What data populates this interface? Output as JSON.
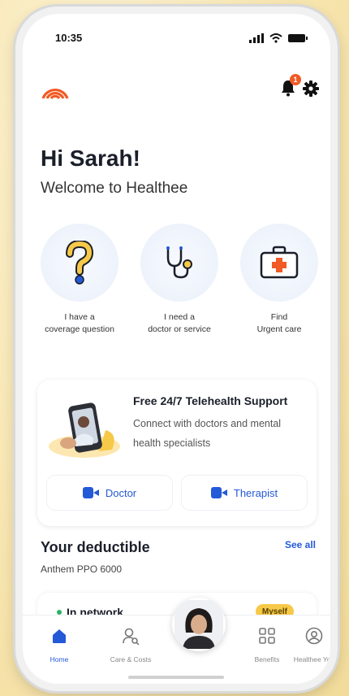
{
  "status_bar": {
    "time": "10:35"
  },
  "header": {
    "notification_count": "1"
  },
  "greeting": {
    "title": "Hi Sarah!",
    "subtitle": "Welcome to Healthee"
  },
  "quick_actions": [
    {
      "icon": "question-mark-icon",
      "line1": "I have a",
      "line2": "coverage question"
    },
    {
      "icon": "stethoscope-icon",
      "line1": "I need a",
      "line2": "doctor or service"
    },
    {
      "icon": "first-aid-kit-icon",
      "line1": "Find",
      "line2": "Urgent care"
    }
  ],
  "telehealth": {
    "title": "Free 24/7 Telehealth Support",
    "subtitle": "Connect with doctors and mental health specialists",
    "doctor_label": "Doctor",
    "therapist_label": "Therapist"
  },
  "deductible": {
    "title": "Your deductible",
    "see_all": "See all",
    "plan": "Anthem PPO 6000",
    "network": "In network",
    "member": "Myself"
  },
  "tabbar": {
    "items": [
      {
        "label": "Home",
        "icon": "home-icon"
      },
      {
        "label": "Care & Costs",
        "icon": "care-costs-icon"
      },
      {
        "label": "Benefits",
        "icon": "benefits-grid-icon"
      },
      {
        "label": "Healthee You",
        "icon": "profile-icon"
      }
    ]
  },
  "colors": {
    "accent_blue": "#2459d8",
    "brand_orange": "#f15a24",
    "badge_yellow": "#f7c948"
  }
}
